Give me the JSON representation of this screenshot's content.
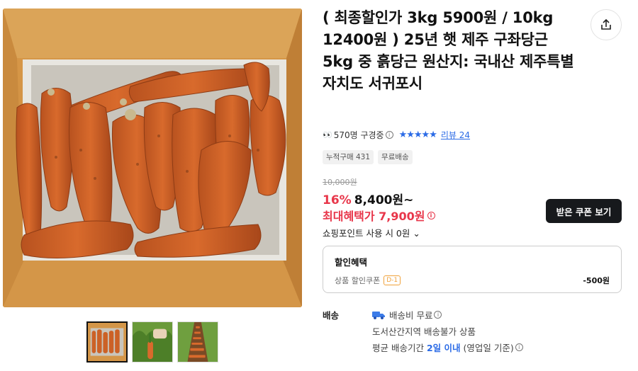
{
  "product": {
    "title": "( 최종할인가 3kg 5900원 / 10kg 12400원 ) 25년 햇 제주 구좌당근 5kg 중 흙당근 원산지: 국내산 제주특별자치도 서귀포시",
    "viewers": "570명 구경중",
    "stars": "★★★★★",
    "review_link": "리뷰 24",
    "chips": [
      "누적구매 431",
      "무료배송"
    ],
    "original_price": "10,000원",
    "discount": "16%",
    "price": "8,400원~",
    "max_benefit": "최대혜택가 7,900원",
    "coupon_button": "받은 쿠폰 보기",
    "points": "쇼핑포인트 사용 시 0원"
  },
  "benefit": {
    "title": "할인혜택",
    "label": "상품 할인쿠폰",
    "dday": "D-1",
    "amount": "-500원"
  },
  "shipping": {
    "label": "배송",
    "fee": "배송비 무료",
    "restriction": "도서산간지역 배송불가 상품",
    "avg_prefix": "평균 배송기간",
    "avg_days": "2일 이내",
    "avg_suffix": "(영업일 기준)"
  },
  "icons": {
    "share": "share-icon",
    "eyes": "👀",
    "info": "i",
    "truck": "truck-icon",
    "chevron": "⌄"
  },
  "colors": {
    "accent_red": "#e8364a",
    "accent_blue": "#2b6be6",
    "button_dark": "#17191c"
  }
}
